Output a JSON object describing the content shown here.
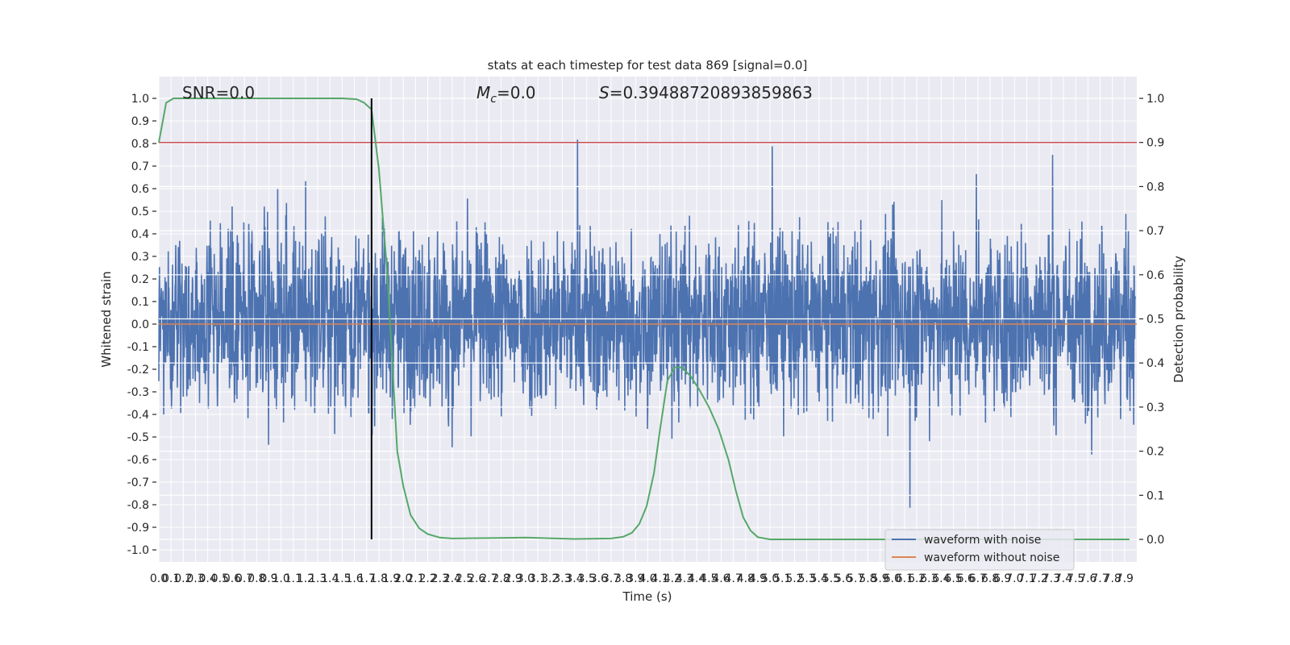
{
  "chart_data": {
    "type": "line",
    "title": "stats at each timestep for test data 869 [signal=0.0]",
    "xlabel": "Time (s)",
    "ylabel": "Whitened strain",
    "ylabel_right": "Detection probability",
    "xlim": [
      0,
      8.0
    ],
    "ylim": [
      -1.1,
      1.1
    ],
    "ylim_right": [
      -0.05,
      1.05
    ],
    "grid": true,
    "legend_position": "lower-right",
    "x_ticks": [
      "0.0",
      "0.1",
      "0.2",
      "0.3",
      "0.4",
      "0.5",
      "0.6",
      "0.7",
      "0.8",
      "0.9",
      "1.0",
      "1.1",
      "1.2",
      "1.3",
      "1.4",
      "1.5",
      "1.6",
      "1.7",
      "1.8",
      "1.9",
      "2.0",
      "2.1",
      "2.2",
      "2.3",
      "2.4",
      "2.5",
      "2.6",
      "2.7",
      "2.8",
      "2.9",
      "3.0",
      "3.1",
      "3.2",
      "3.3",
      "3.4",
      "3.5",
      "3.6",
      "3.7",
      "3.8",
      "3.9",
      "4.0",
      "4.1",
      "4.2",
      "4.3",
      "4.4",
      "4.5",
      "4.6",
      "4.7",
      "4.8",
      "4.9",
      "5.0",
      "5.1",
      "5.2",
      "5.3",
      "5.4",
      "5.5",
      "5.6",
      "5.7",
      "5.8",
      "5.9",
      "6.0",
      "6.1",
      "6.2",
      "6.3",
      "6.4",
      "6.5",
      "6.6",
      "6.7",
      "6.8",
      "6.9",
      "7.0",
      "7.1",
      "7.2",
      "7.3",
      "7.4",
      "7.5",
      "7.6",
      "7.7",
      "7.8",
      "7.9"
    ],
    "y_ticks_left": [
      "1.0",
      "0.9",
      "0.8",
      "0.7",
      "0.6",
      "0.5",
      "0.4",
      "0.3",
      "0.2",
      "0.1",
      "0.0",
      "-0.1",
      "-0.2",
      "-0.3",
      "-0.4",
      "-0.5",
      "-0.6",
      "-0.7",
      "-0.8",
      "-0.9",
      "-1.0"
    ],
    "y_ticks_right": [
      "1.0",
      "0.9",
      "0.8",
      "0.7",
      "0.6",
      "0.5",
      "0.4",
      "0.3",
      "0.2",
      "0.1",
      "0.0"
    ],
    "annotations": {
      "snr": "SNR=0.0",
      "mc_symbol": "M",
      "mc_sub": "c",
      "mc_value": "=0.0",
      "s_symbol": "S",
      "s_value": "=0.39488720893859863"
    },
    "series": [
      {
        "name": "waveform with noise",
        "axis": "left",
        "color": "#4C72B0",
        "noise_range": [
          -0.96,
          0.96
        ]
      },
      {
        "name": "waveform without noise",
        "axis": "left",
        "color": "#DD8452",
        "values_constant": 0.0
      }
    ],
    "detection_probability": {
      "axis": "right",
      "color": "#55A868",
      "points": [
        [
          0,
          0.9
        ],
        [
          0.06,
          0.99
        ],
        [
          0.12,
          1.0
        ],
        [
          1.5,
          1.0
        ],
        [
          1.62,
          0.998
        ],
        [
          1.68,
          0.99
        ],
        [
          1.74,
          0.975
        ],
        [
          1.8,
          0.84
        ],
        [
          1.87,
          0.6
        ],
        [
          1.91,
          0.4
        ],
        [
          1.95,
          0.2
        ],
        [
          2.0,
          0.12
        ],
        [
          2.06,
          0.055
        ],
        [
          2.13,
          0.025
        ],
        [
          2.2,
          0.012
        ],
        [
          2.3,
          0.004
        ],
        [
          2.4,
          0.002
        ],
        [
          3.0,
          0.004
        ],
        [
          3.4,
          0.001
        ],
        [
          3.7,
          0.002
        ],
        [
          3.8,
          0.006
        ],
        [
          3.87,
          0.015
        ],
        [
          3.93,
          0.035
        ],
        [
          3.99,
          0.075
        ],
        [
          4.05,
          0.15
        ],
        [
          4.1,
          0.25
        ],
        [
          4.16,
          0.36
        ],
        [
          4.22,
          0.39
        ],
        [
          4.28,
          0.39
        ],
        [
          4.35,
          0.37
        ],
        [
          4.42,
          0.34
        ],
        [
          4.5,
          0.3
        ],
        [
          4.58,
          0.25
        ],
        [
          4.66,
          0.18
        ],
        [
          4.72,
          0.11
        ],
        [
          4.78,
          0.05
        ],
        [
          4.84,
          0.02
        ],
        [
          4.9,
          0.005
        ],
        [
          5.0,
          0.0
        ],
        [
          7.94,
          0.0
        ]
      ]
    },
    "threshold": {
      "axis": "right",
      "value": 0.9,
      "color": "#C44E52"
    },
    "marker_time": {
      "value": 1.74,
      "color": "#000000"
    },
    "background": "#EAEAF2"
  }
}
